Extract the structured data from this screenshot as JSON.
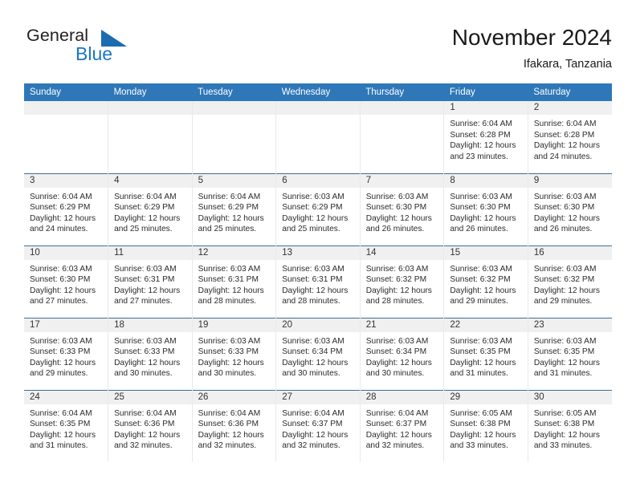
{
  "brand": {
    "name_part1": "General",
    "name_part2": "Blue",
    "triangle_color": "#1b6cb0",
    "blue_color": "#1b76c4"
  },
  "header": {
    "title": "November 2024",
    "location": "Ifakara, Tanzania"
  },
  "theme": {
    "header_blue": "#2e77b8",
    "daynum_band": "#f0f0f0",
    "row_divider": "#3f6e96"
  },
  "weekday_headers": [
    "Sunday",
    "Monday",
    "Tuesday",
    "Wednesday",
    "Thursday",
    "Friday",
    "Saturday"
  ],
  "weeks": [
    [
      {
        "day": "",
        "blank": true,
        "sunrise": "",
        "sunset": "",
        "daylight_line1": "",
        "daylight_line2": ""
      },
      {
        "day": "",
        "blank": true,
        "sunrise": "",
        "sunset": "",
        "daylight_line1": "",
        "daylight_line2": ""
      },
      {
        "day": "",
        "blank": true,
        "sunrise": "",
        "sunset": "",
        "daylight_line1": "",
        "daylight_line2": ""
      },
      {
        "day": "",
        "blank": true,
        "sunrise": "",
        "sunset": "",
        "daylight_line1": "",
        "daylight_line2": ""
      },
      {
        "day": "",
        "blank": true,
        "sunrise": "",
        "sunset": "",
        "daylight_line1": "",
        "daylight_line2": ""
      },
      {
        "day": "1",
        "sunrise": "Sunrise: 6:04 AM",
        "sunset": "Sunset: 6:28 PM",
        "daylight_line1": "Daylight: 12 hours",
        "daylight_line2": "and 23 minutes."
      },
      {
        "day": "2",
        "sunrise": "Sunrise: 6:04 AM",
        "sunset": "Sunset: 6:28 PM",
        "daylight_line1": "Daylight: 12 hours",
        "daylight_line2": "and 24 minutes."
      }
    ],
    [
      {
        "day": "3",
        "sunrise": "Sunrise: 6:04 AM",
        "sunset": "Sunset: 6:29 PM",
        "daylight_line1": "Daylight: 12 hours",
        "daylight_line2": "and 24 minutes."
      },
      {
        "day": "4",
        "sunrise": "Sunrise: 6:04 AM",
        "sunset": "Sunset: 6:29 PM",
        "daylight_line1": "Daylight: 12 hours",
        "daylight_line2": "and 25 minutes."
      },
      {
        "day": "5",
        "sunrise": "Sunrise: 6:04 AM",
        "sunset": "Sunset: 6:29 PM",
        "daylight_line1": "Daylight: 12 hours",
        "daylight_line2": "and 25 minutes."
      },
      {
        "day": "6",
        "sunrise": "Sunrise: 6:03 AM",
        "sunset": "Sunset: 6:29 PM",
        "daylight_line1": "Daylight: 12 hours",
        "daylight_line2": "and 25 minutes."
      },
      {
        "day": "7",
        "sunrise": "Sunrise: 6:03 AM",
        "sunset": "Sunset: 6:30 PM",
        "daylight_line1": "Daylight: 12 hours",
        "daylight_line2": "and 26 minutes."
      },
      {
        "day": "8",
        "sunrise": "Sunrise: 6:03 AM",
        "sunset": "Sunset: 6:30 PM",
        "daylight_line1": "Daylight: 12 hours",
        "daylight_line2": "and 26 minutes."
      },
      {
        "day": "9",
        "sunrise": "Sunrise: 6:03 AM",
        "sunset": "Sunset: 6:30 PM",
        "daylight_line1": "Daylight: 12 hours",
        "daylight_line2": "and 26 minutes."
      }
    ],
    [
      {
        "day": "10",
        "sunrise": "Sunrise: 6:03 AM",
        "sunset": "Sunset: 6:30 PM",
        "daylight_line1": "Daylight: 12 hours",
        "daylight_line2": "and 27 minutes."
      },
      {
        "day": "11",
        "sunrise": "Sunrise: 6:03 AM",
        "sunset": "Sunset: 6:31 PM",
        "daylight_line1": "Daylight: 12 hours",
        "daylight_line2": "and 27 minutes."
      },
      {
        "day": "12",
        "sunrise": "Sunrise: 6:03 AM",
        "sunset": "Sunset: 6:31 PM",
        "daylight_line1": "Daylight: 12 hours",
        "daylight_line2": "and 28 minutes."
      },
      {
        "day": "13",
        "sunrise": "Sunrise: 6:03 AM",
        "sunset": "Sunset: 6:31 PM",
        "daylight_line1": "Daylight: 12 hours",
        "daylight_line2": "and 28 minutes."
      },
      {
        "day": "14",
        "sunrise": "Sunrise: 6:03 AM",
        "sunset": "Sunset: 6:32 PM",
        "daylight_line1": "Daylight: 12 hours",
        "daylight_line2": "and 28 minutes."
      },
      {
        "day": "15",
        "sunrise": "Sunrise: 6:03 AM",
        "sunset": "Sunset: 6:32 PM",
        "daylight_line1": "Daylight: 12 hours",
        "daylight_line2": "and 29 minutes."
      },
      {
        "day": "16",
        "sunrise": "Sunrise: 6:03 AM",
        "sunset": "Sunset: 6:32 PM",
        "daylight_line1": "Daylight: 12 hours",
        "daylight_line2": "and 29 minutes."
      }
    ],
    [
      {
        "day": "17",
        "sunrise": "Sunrise: 6:03 AM",
        "sunset": "Sunset: 6:33 PM",
        "daylight_line1": "Daylight: 12 hours",
        "daylight_line2": "and 29 minutes."
      },
      {
        "day": "18",
        "sunrise": "Sunrise: 6:03 AM",
        "sunset": "Sunset: 6:33 PM",
        "daylight_line1": "Daylight: 12 hours",
        "daylight_line2": "and 30 minutes."
      },
      {
        "day": "19",
        "sunrise": "Sunrise: 6:03 AM",
        "sunset": "Sunset: 6:33 PM",
        "daylight_line1": "Daylight: 12 hours",
        "daylight_line2": "and 30 minutes."
      },
      {
        "day": "20",
        "sunrise": "Sunrise: 6:03 AM",
        "sunset": "Sunset: 6:34 PM",
        "daylight_line1": "Daylight: 12 hours",
        "daylight_line2": "and 30 minutes."
      },
      {
        "day": "21",
        "sunrise": "Sunrise: 6:03 AM",
        "sunset": "Sunset: 6:34 PM",
        "daylight_line1": "Daylight: 12 hours",
        "daylight_line2": "and 30 minutes."
      },
      {
        "day": "22",
        "sunrise": "Sunrise: 6:03 AM",
        "sunset": "Sunset: 6:35 PM",
        "daylight_line1": "Daylight: 12 hours",
        "daylight_line2": "and 31 minutes."
      },
      {
        "day": "23",
        "sunrise": "Sunrise: 6:03 AM",
        "sunset": "Sunset: 6:35 PM",
        "daylight_line1": "Daylight: 12 hours",
        "daylight_line2": "and 31 minutes."
      }
    ],
    [
      {
        "day": "24",
        "sunrise": "Sunrise: 6:04 AM",
        "sunset": "Sunset: 6:35 PM",
        "daylight_line1": "Daylight: 12 hours",
        "daylight_line2": "and 31 minutes."
      },
      {
        "day": "25",
        "sunrise": "Sunrise: 6:04 AM",
        "sunset": "Sunset: 6:36 PM",
        "daylight_line1": "Daylight: 12 hours",
        "daylight_line2": "and 32 minutes."
      },
      {
        "day": "26",
        "sunrise": "Sunrise: 6:04 AM",
        "sunset": "Sunset: 6:36 PM",
        "daylight_line1": "Daylight: 12 hours",
        "daylight_line2": "and 32 minutes."
      },
      {
        "day": "27",
        "sunrise": "Sunrise: 6:04 AM",
        "sunset": "Sunset: 6:37 PM",
        "daylight_line1": "Daylight: 12 hours",
        "daylight_line2": "and 32 minutes."
      },
      {
        "day": "28",
        "sunrise": "Sunrise: 6:04 AM",
        "sunset": "Sunset: 6:37 PM",
        "daylight_line1": "Daylight: 12 hours",
        "daylight_line2": "and 32 minutes."
      },
      {
        "day": "29",
        "sunrise": "Sunrise: 6:05 AM",
        "sunset": "Sunset: 6:38 PM",
        "daylight_line1": "Daylight: 12 hours",
        "daylight_line2": "and 33 minutes."
      },
      {
        "day": "30",
        "sunrise": "Sunrise: 6:05 AM",
        "sunset": "Sunset: 6:38 PM",
        "daylight_line1": "Daylight: 12 hours",
        "daylight_line2": "and 33 minutes."
      }
    ]
  ]
}
